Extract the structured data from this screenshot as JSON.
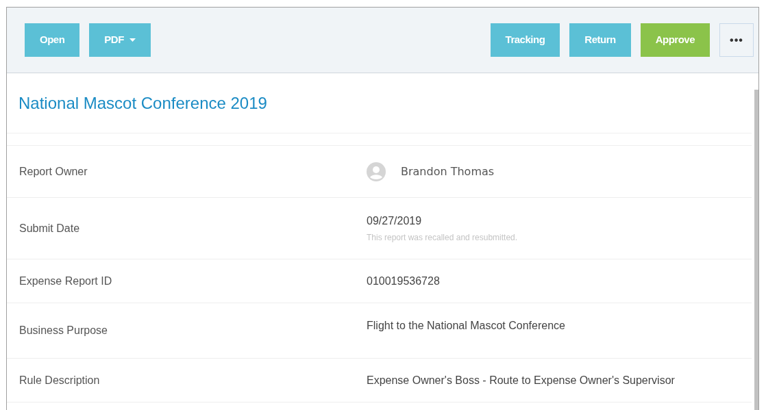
{
  "toolbar": {
    "left_buttons": [
      {
        "label": "Open",
        "kind": "primary"
      },
      {
        "label": "PDF",
        "kind": "dropdown"
      }
    ],
    "right_buttons": [
      {
        "label": "Tracking",
        "kind": "primary"
      },
      {
        "label": "Return",
        "kind": "primary"
      },
      {
        "label": "Approve",
        "kind": "success"
      },
      {
        "label": "•••",
        "kind": "more"
      }
    ]
  },
  "report": {
    "title": "National Mascot Conference 2019",
    "fields": [
      {
        "label": "Report Owner",
        "kind": "person",
        "value": "Brandon Thomas"
      },
      {
        "label": "Submit Date",
        "kind": "note",
        "value": "09/27/2019",
        "note": "This report was recalled and resubmitted."
      },
      {
        "label": "Expense Report ID",
        "kind": "text",
        "value": "010019536728"
      },
      {
        "label": "Business Purpose",
        "kind": "tall",
        "value": "Flight to the National Mascot Conference"
      },
      {
        "label": "Rule Description",
        "kind": "text",
        "value": "Expense Owner's Boss - Route to Expense Owner's Supervisor"
      }
    ]
  }
}
